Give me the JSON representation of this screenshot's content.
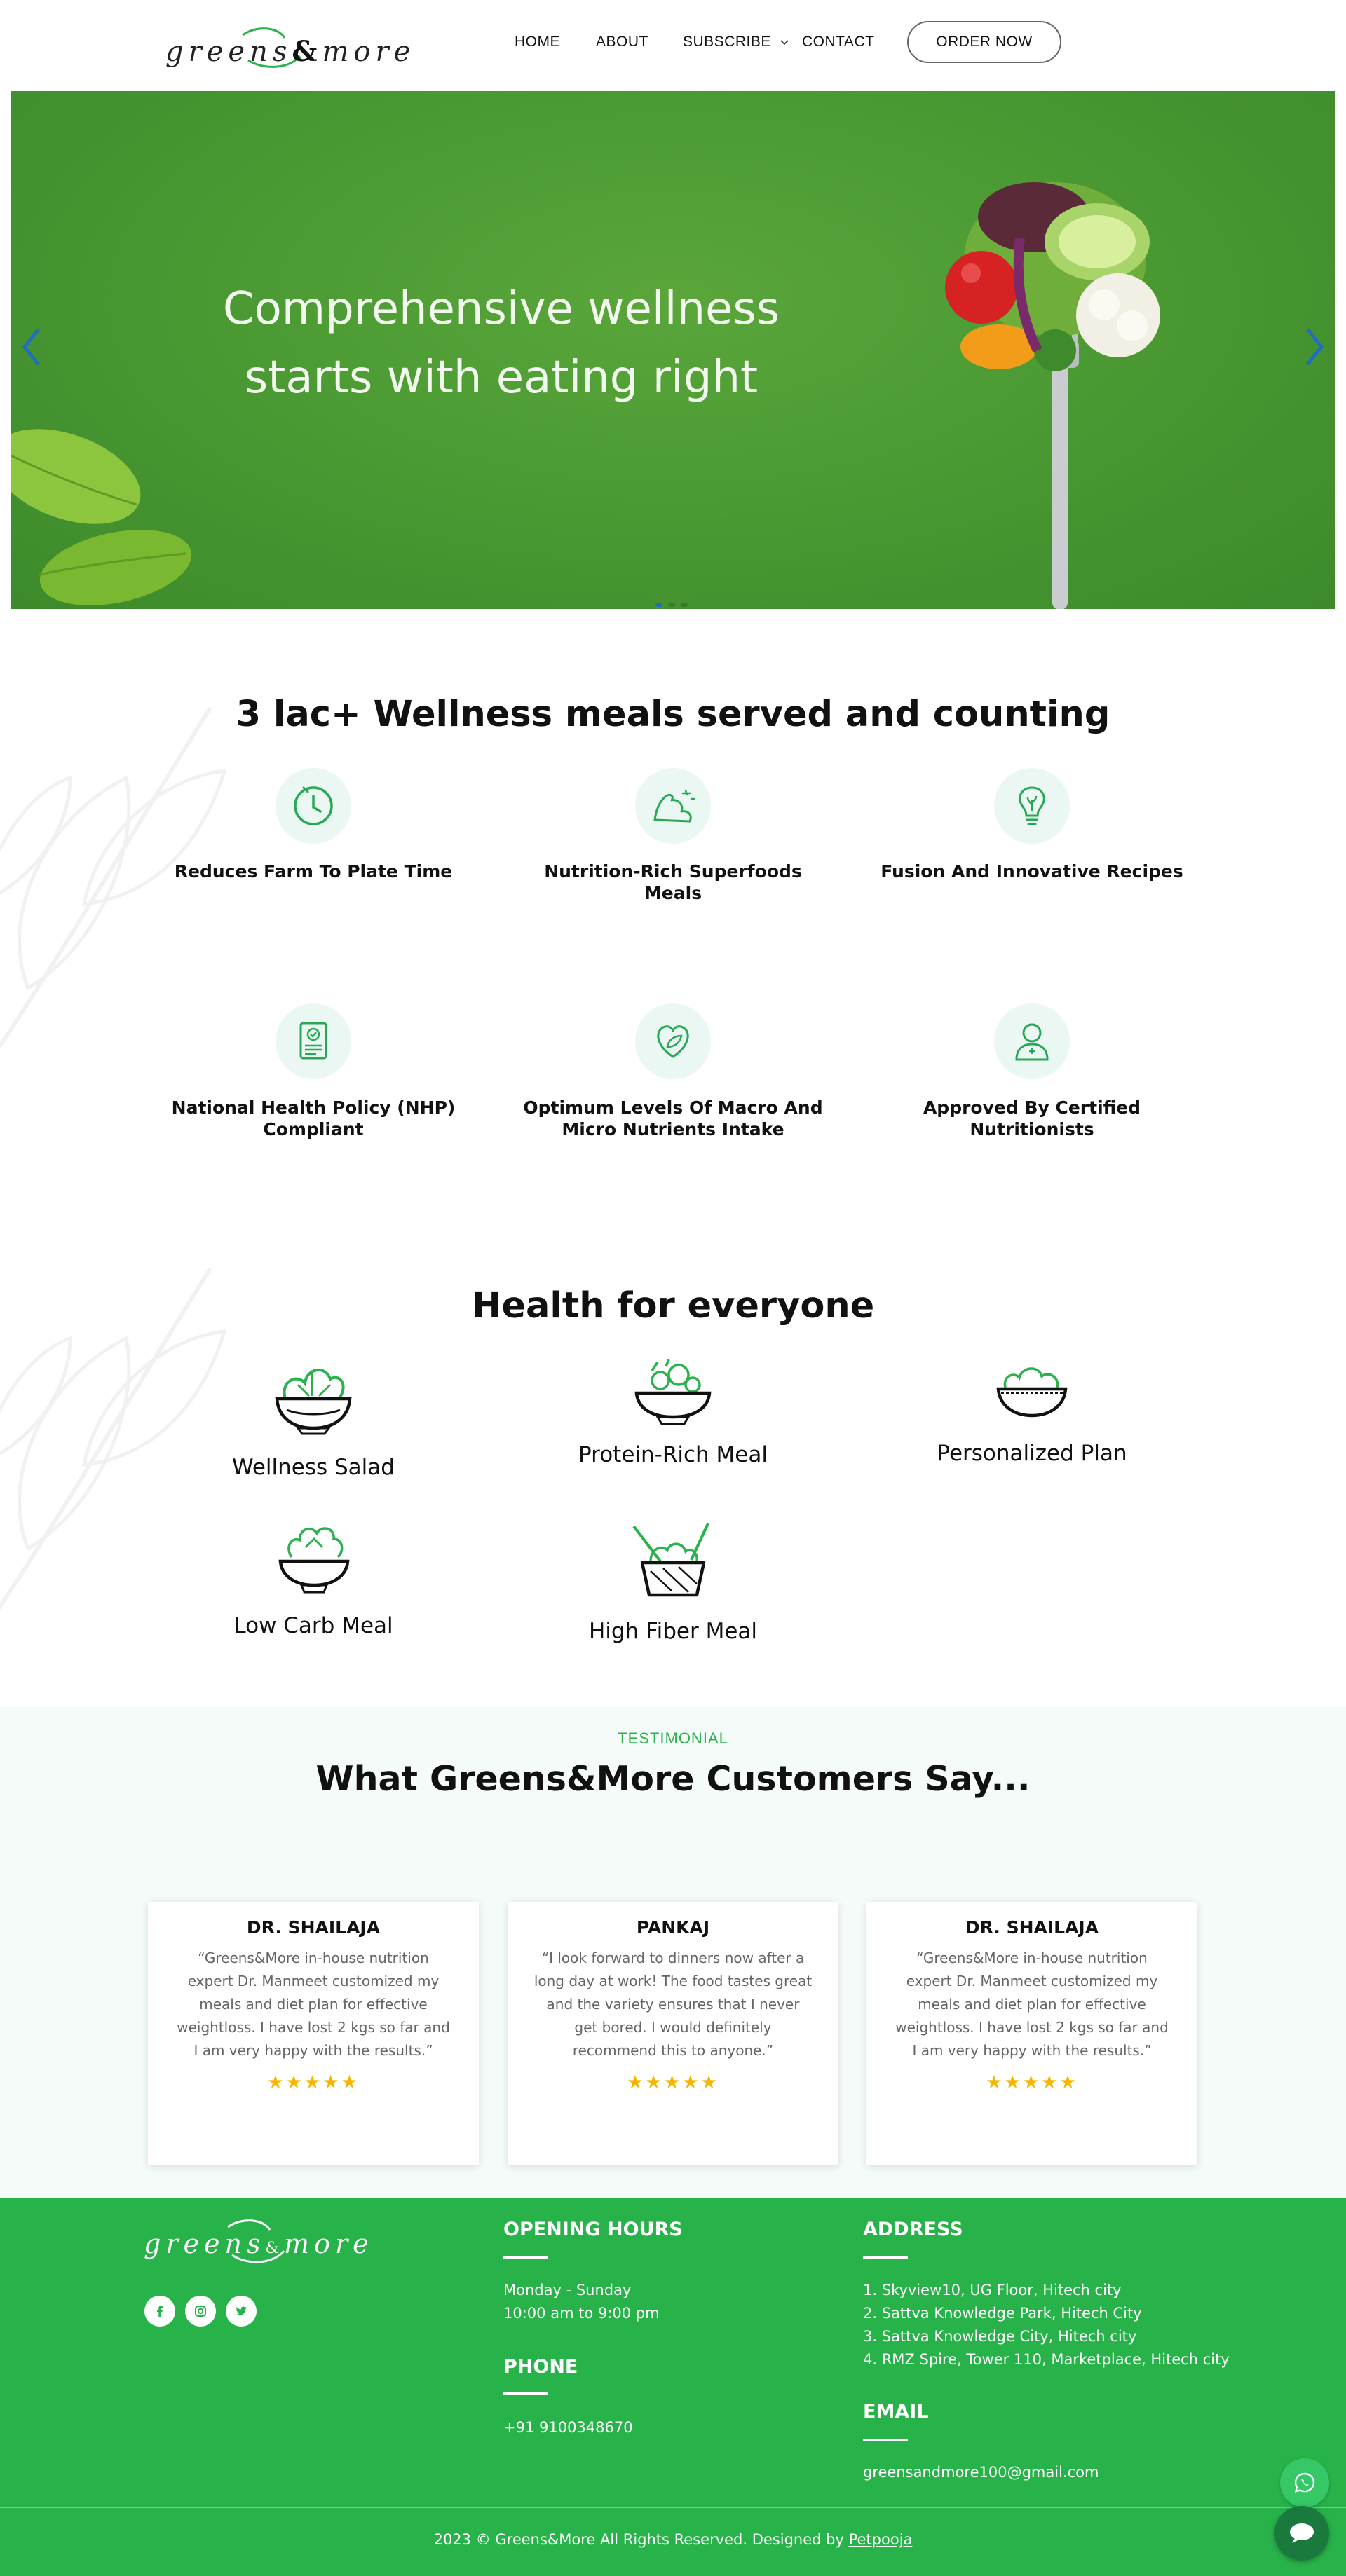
{
  "brand": {
    "logo_text_left": "greens",
    "logo_amp": "&",
    "logo_text_right": "more",
    "accent": "#28b34a",
    "hero_green": "#4b9a33"
  },
  "nav": {
    "items": [
      {
        "label": "HOME"
      },
      {
        "label": "ABOUT"
      },
      {
        "label": "SUBSCRIBE"
      },
      {
        "label": "CONTACT"
      }
    ],
    "order_button": "ORDER NOW"
  },
  "hero": {
    "headline_line1": "Comprehensive wellness",
    "headline_line2": "starts with eating right",
    "prev_icon": "chevron-left-icon",
    "next_icon": "chevron-right-icon"
  },
  "stats": {
    "title": "3 lac+ Wellness meals served and counting",
    "features": [
      {
        "label": "Reduces Farm To Plate Time",
        "icon": "clock-icon"
      },
      {
        "label": "Nutrition-Rich Superfoods Meals",
        "icon": "strength-icon"
      },
      {
        "label": "Fusion And Innovative Recipes",
        "icon": "lightbulb-icon"
      },
      {
        "label": "National Health Policy (NHP) Compliant",
        "icon": "certificate-icon"
      },
      {
        "label": "Optimum Levels Of Macro And Micro Nutrients Intake",
        "icon": "heart-leaf-icon"
      },
      {
        "label": "Approved By Certified Nutritionists",
        "icon": "nutritionist-icon"
      }
    ]
  },
  "meals": {
    "title": "Health for everyone",
    "items": [
      {
        "label": "Wellness Salad",
        "icon": "salad-bowl-icon"
      },
      {
        "label": "Protein-Rich Meal",
        "icon": "protein-bowl-icon"
      },
      {
        "label": "Personalized Plan",
        "icon": "plan-bowl-icon"
      },
      {
        "label": "Low Carb Meal",
        "icon": "lowcarb-bowl-icon"
      },
      {
        "label": "High Fiber Meal",
        "icon": "fiber-bowl-icon"
      }
    ]
  },
  "testimonials": {
    "tag": "TESTIMONIAL",
    "title": "What Greens&More Customers Say...",
    "cards": [
      {
        "name": "DR. SHAILAJA",
        "text": "“Greens&More in-house nutrition expert Dr. Manmeet customized my meals and diet plan for effective weightloss. I have lost 2 kgs so far and I am very happy with the results.”",
        "stars": "★★★★★"
      },
      {
        "name": "PANKAJ",
        "text": "“I look forward to dinners now after a long day at work! The food tastes great and the variety ensures that I never get bored. I would definitely recommend this to anyone.”",
        "stars": "★★★★★"
      },
      {
        "name": "DR. SHAILAJA",
        "text": "“Greens&More in-house nutrition expert Dr. Manmeet customized my meals and diet plan for effective weightloss. I have lost 2 kgs so far and I am very happy with the results.”",
        "stars": "★★★★★"
      }
    ]
  },
  "footer": {
    "opening_hours": {
      "heading": "OPENING HOURS",
      "line1": "Monday - Sunday",
      "line2": "10:00 am to 9:00 pm"
    },
    "phone": {
      "heading": "PHONE",
      "number": "+91 9100348670"
    },
    "address": {
      "heading": "ADDRESS",
      "lines": [
        "1. Skyview10, UG Floor, Hitech city",
        "2. Sattva Knowledge Park, Hitech City",
        "3. Sattva Knowledge City, Hitech city",
        "4. RMZ Spire, Tower 110, Marketplace, Hitech city"
      ]
    },
    "email": {
      "heading": "EMAIL",
      "address": "greensandmore100@gmail.com"
    },
    "social": [
      "facebook-icon",
      "instagram-icon",
      "twitter-icon"
    ],
    "copyright_text": "2023 © Greens&More All Rights Reserved. Designed by ",
    "designer": "Petpooja"
  }
}
